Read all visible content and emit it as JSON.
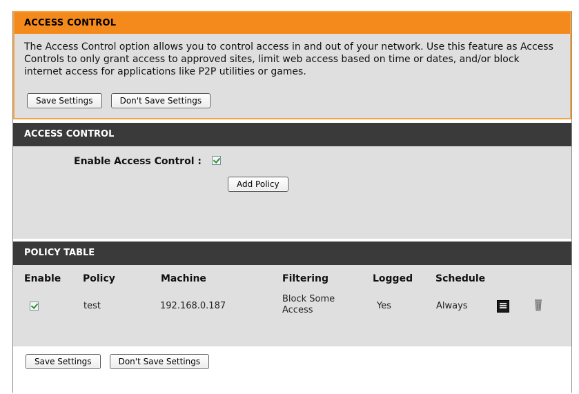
{
  "intro": {
    "title": "ACCESS CONTROL",
    "text": "The Access Control option allows you to control access in and out of your network. Use this feature as Access Controls to only grant access to approved sites, limit web access based on time or dates, and/or block internet access for applications like P2P utilities or games.",
    "save_label": "Save Settings",
    "dont_save_label": "Don't Save Settings"
  },
  "access_control": {
    "title": "ACCESS CONTROL",
    "enable_label": "Enable Access Control :",
    "enabled": true,
    "add_policy_label": "Add Policy"
  },
  "policy_table": {
    "title": "POLICY TABLE",
    "headers": {
      "enable": "Enable",
      "policy": "Policy",
      "machine": "Machine",
      "filtering": "Filtering",
      "logged": "Logged",
      "schedule": "Schedule"
    },
    "rows": [
      {
        "enabled": true,
        "policy": "test",
        "machine": "192.168.0.187",
        "filtering_line1": "Block Some",
        "filtering_line2": "Access",
        "logged": "Yes",
        "schedule": "Always",
        "edit_icon": "edit-icon",
        "delete_icon": "trash-icon"
      }
    ]
  },
  "footer": {
    "save_label": "Save Settings",
    "dont_save_label": "Don't Save Settings"
  },
  "colors": {
    "intro_header": "#f48a1c",
    "section_header": "#3a3a3a",
    "panel_bg": "#dfdfdf",
    "check": "#2f8a2f"
  }
}
